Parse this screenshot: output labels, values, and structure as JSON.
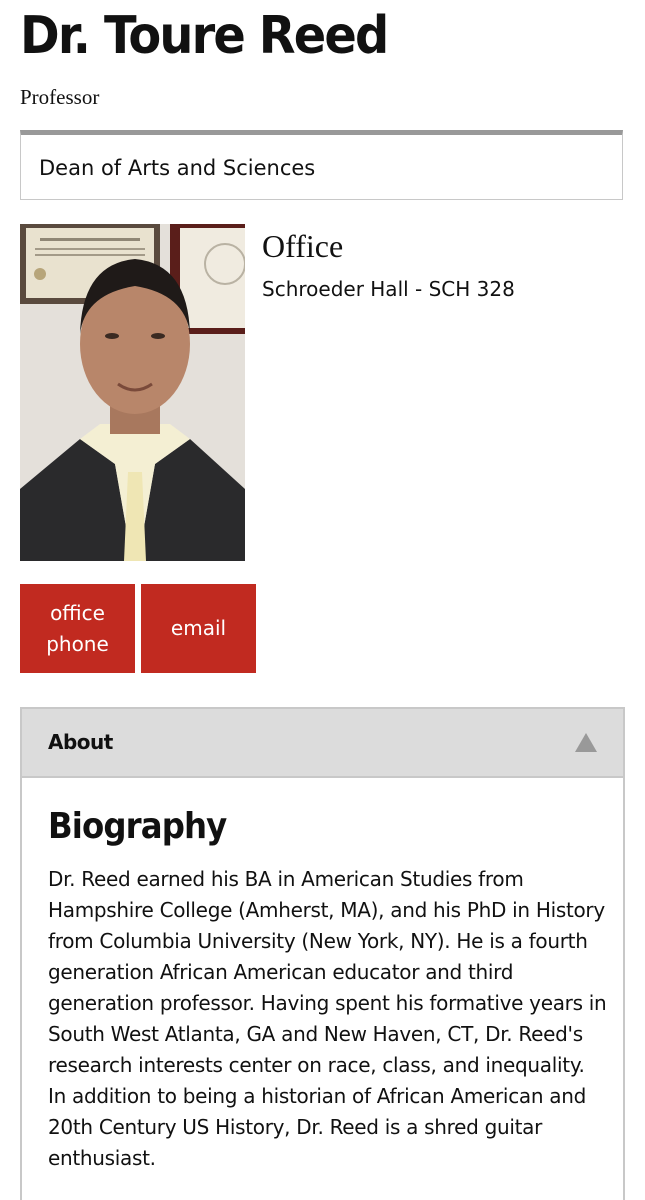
{
  "profile": {
    "name": "Dr. Toure Reed",
    "title": "Professor",
    "department": "Dean of Arts and Sciences",
    "photo_icon": "portrait-photo"
  },
  "office": {
    "heading": "Office",
    "location": "Schroeder Hall - SCH 328"
  },
  "contact": {
    "phone_label": "office phone",
    "email_label": "email",
    "button_color": "#c12a20"
  },
  "about": {
    "label": "About",
    "toggle_icon": "triangle-up-icon",
    "bio_heading": "Biography",
    "bio_text": "Dr. Reed earned his BA in American Studies from Hampshire College (Amherst, MA), and his PhD in History from Columbia University (New York, NY). He is a fourth generation African American educator and third generation professor. Having spent his formative years in South West Atlanta, GA and New Haven, CT, Dr. Reed's research interests center on race, class, and inequality. In addition to being a historian of African American and 20th Century US History, Dr. Reed is a shred guitar enthusiast."
  }
}
